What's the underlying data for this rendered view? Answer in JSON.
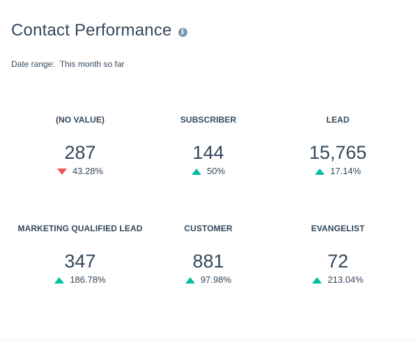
{
  "header": {
    "title": "Contact Performance",
    "info_icon": "info-icon"
  },
  "date_range": {
    "label": "Date range:",
    "value": "This month so far"
  },
  "colors": {
    "up": "#00bda5",
    "down": "#f2545b",
    "text": "#33475b"
  },
  "stats": [
    {
      "label": "(NO VALUE)",
      "value": "287",
      "change": "43.28%",
      "direction": "down"
    },
    {
      "label": "SUBSCRIBER",
      "value": "144",
      "change": "50%",
      "direction": "up"
    },
    {
      "label": "LEAD",
      "value": "15,765",
      "change": "17.14%",
      "direction": "up"
    },
    {
      "label": "MARKETING QUALIFIED LEAD",
      "value": "347",
      "change": "186.78%",
      "direction": "up"
    },
    {
      "label": "CUSTOMER",
      "value": "881",
      "change": "97.98%",
      "direction": "up"
    },
    {
      "label": "EVANGELIST",
      "value": "72",
      "change": "213.04%",
      "direction": "up"
    }
  ]
}
